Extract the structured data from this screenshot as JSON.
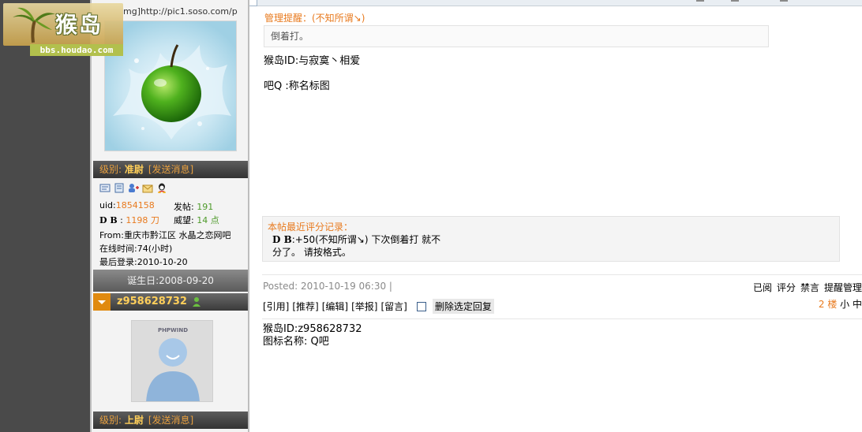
{
  "logo": {
    "title": "猴岛",
    "url": "bbs.houdao.com"
  },
  "user1": {
    "avatar_url_text": "mg]http://pic1.soso.com/p",
    "rank_prefix": "级别: ",
    "rank": "准尉",
    "send_message": "[发送消息]",
    "uid_label": "uid:",
    "uid": "1854158",
    "posts_label": "发帖:",
    "posts": "191",
    "db_label": "D B",
    "db_value": "1198 刀",
    "prestige_label": "威望:",
    "prestige": "14 点",
    "from": "From:重庆市黔江区 水晶之恋网吧",
    "online_time": "在线时间:74(小时)",
    "last_login": "最后登录:2010-10-20",
    "birthday": "诞生日:2008-09-20"
  },
  "user2": {
    "name": "z958628732",
    "avatar_text": "PHPWIND",
    "rank_prefix": "级别: ",
    "rank": "上尉",
    "send_message": "[发送消息]"
  },
  "post1": {
    "mgmt_label": "管理提醒：(不知所谓↘)",
    "mgmt_text": "倒着打。",
    "line1": "猴岛ID:与寂寞丶相爱",
    "line2": "吧Q :称名标图",
    "rating_title": "本帖最近评分记录：",
    "rating_db": "D B",
    "rating_line1": ":+50(不知所谓↘) 下次倒着打 就不",
    "rating_line2": "分了。 请按格式。"
  },
  "post2": {
    "posted": "Posted: 2010-10-19 06:30 |",
    "admin_links": [
      "已阅",
      "评分",
      "禁言",
      "提醒管理"
    ],
    "actions": [
      "[引用]",
      "[推荐]",
      "[编辑]",
      "[举报]",
      "[留言]"
    ],
    "delete_selected": "删除选定回复",
    "floor_num": "2 楼",
    "floor_extra": "小 中",
    "line1": "猴岛ID:z958628732",
    "line2": "图标名称: Q吧"
  }
}
